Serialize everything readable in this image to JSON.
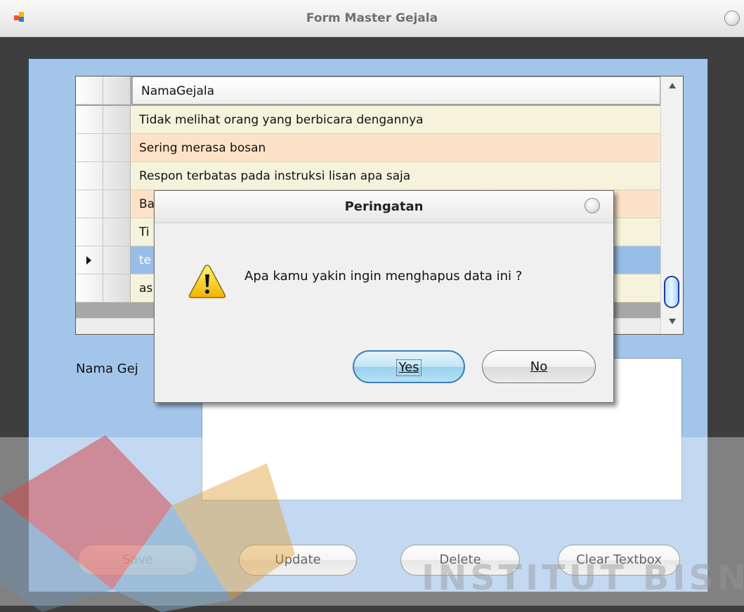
{
  "window": {
    "title": "Form Master Gejala"
  },
  "grid": {
    "column_header": "NamaGejala",
    "rows": [
      {
        "text": "Tidak melihat orang yang berbicara dengannya",
        "style": "odd",
        "selected": false
      },
      {
        "text": "Sering merasa bosan",
        "style": "even",
        "selected": false
      },
      {
        "text": "Respon terbatas pada instruksi lisan apa saja",
        "style": "odd",
        "selected": false
      },
      {
        "text": "Ba",
        "style": "even",
        "selected": false
      },
      {
        "text": "Ti",
        "style": "odd",
        "selected": false
      },
      {
        "text": "te",
        "style": "selected",
        "selected": true
      },
      {
        "text": "as",
        "style": "odd",
        "selected": false
      }
    ]
  },
  "form": {
    "label_nama": "Nama Gej",
    "textbox_value": ""
  },
  "buttons": {
    "save": "Save",
    "update": "Update",
    "delete": "Delete",
    "clear": "Clear Textbox"
  },
  "dialog": {
    "title": "Peringatan",
    "message": "Apa kamu yakin ingin menghapus data ini ?",
    "yes_label": "Yes",
    "no_label": "No",
    "icon": "warning-icon"
  },
  "watermark": {
    "text": "INSTITUT BISNIS"
  },
  "colors": {
    "client_bg": "#a3c5ea",
    "row_odd": "#f5f3dc",
    "row_even": "#fde2c8",
    "row_selected": "#98bde8",
    "dialog_bg": "#f0f0f0"
  }
}
